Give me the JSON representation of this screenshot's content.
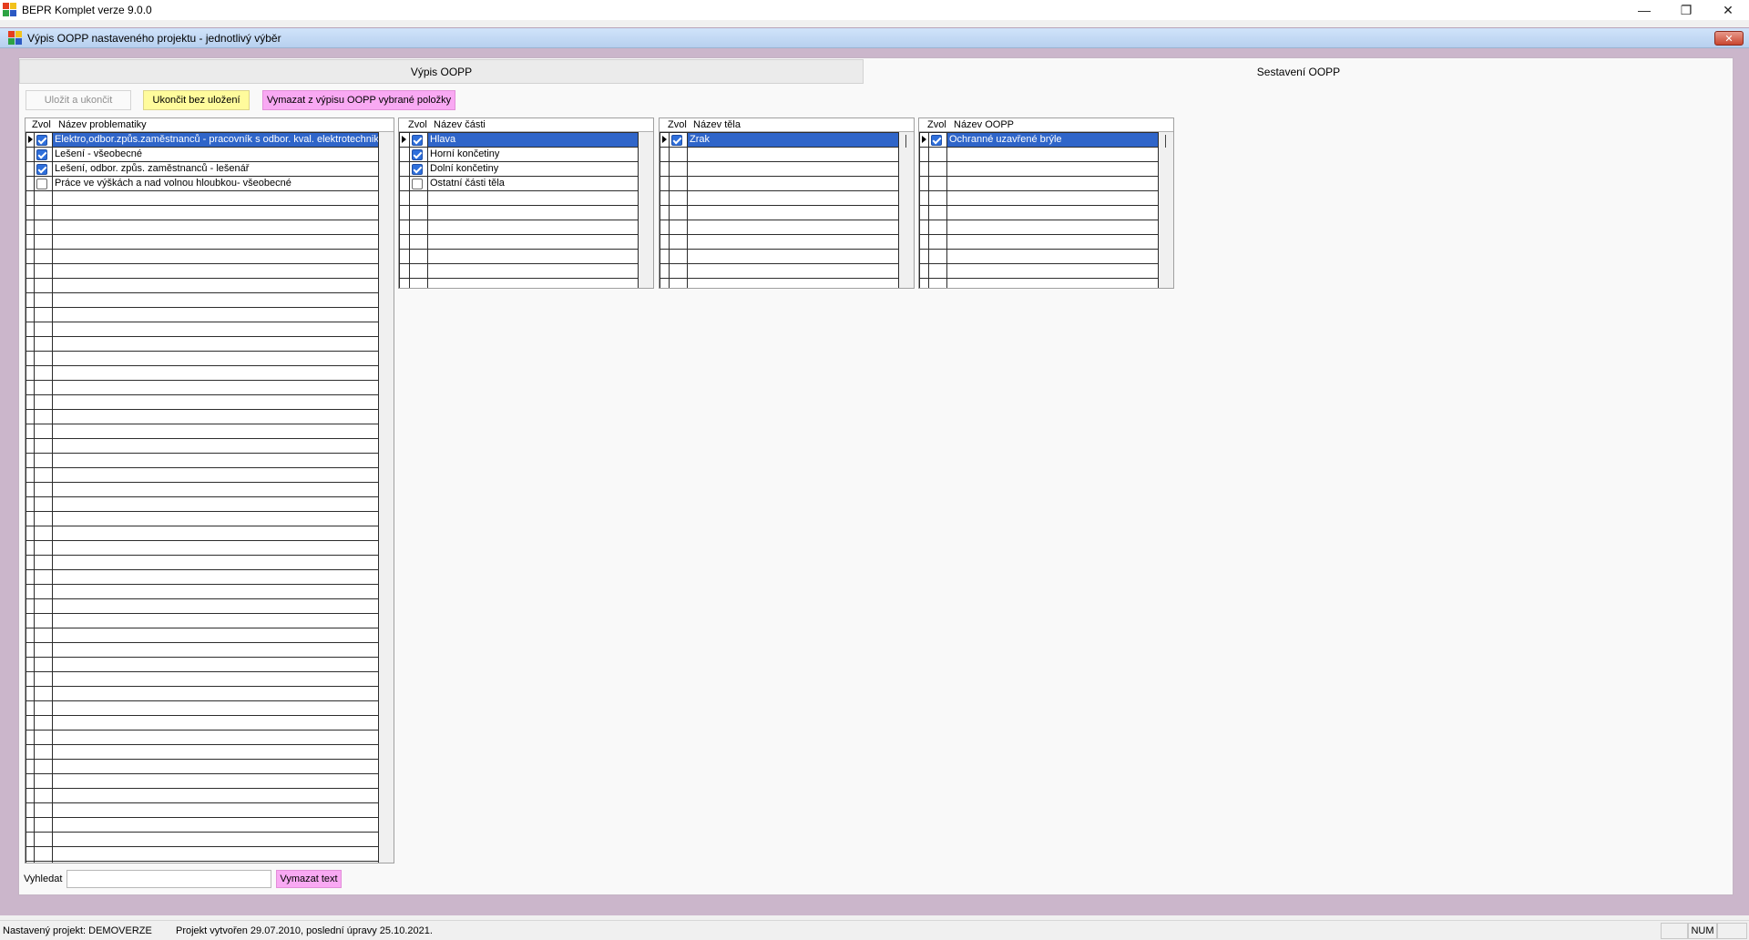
{
  "app": {
    "title": "BEPR Komplet verze 9.0.0",
    "window_controls": {
      "minimize": "—",
      "restore": "❐",
      "close": "✕"
    }
  },
  "child_window": {
    "title": "Výpis OOPP nastaveného projektu - jednotlivý výběr",
    "close": "✕"
  },
  "tabs": [
    {
      "label": "Výpis OOPP",
      "active": false
    },
    {
      "label": "Sestavení OOPP",
      "active": true
    }
  ],
  "toolbar": {
    "save_exit": "Uložit a ukončit",
    "exit_nosave": "Ukončit bez uložení",
    "delete_selected": "Vymazat z výpisu OOPP vybrané položky"
  },
  "grids": {
    "problematika": {
      "col_select": "Zvol",
      "col_name": "Název problematiky",
      "rows": [
        {
          "checked": true,
          "text": "Elektro,odbor.způs.zaměstnanců - pracovník s odbor. kval. elektrotechnika",
          "selected": true
        },
        {
          "checked": true,
          "text": "Lešení - všeobecné",
          "selected": false
        },
        {
          "checked": true,
          "text": "Lešení, odbor. způs. zaměstnanců - lešenář",
          "selected": false
        },
        {
          "checked": false,
          "text": "Práce ve výškách a nad volnou hloubkou- všeobecné",
          "selected": false
        }
      ]
    },
    "casti": {
      "col_select": "Zvol",
      "col_name": "Název části",
      "rows": [
        {
          "checked": true,
          "text": "Hlava",
          "selected": true
        },
        {
          "checked": true,
          "text": "Horní končetiny",
          "selected": false
        },
        {
          "checked": true,
          "text": "Dolní končetiny",
          "selected": false
        },
        {
          "checked": false,
          "text": "Ostatní části těla",
          "selected": false
        }
      ]
    },
    "tela": {
      "col_select": "Zvol",
      "col_name": "Název těla",
      "rows": [
        {
          "checked": true,
          "text": "Zrak",
          "selected": true
        }
      ]
    },
    "oopp": {
      "col_select": "Zvol",
      "col_name": "Název OOPP",
      "rows": [
        {
          "checked": true,
          "text": "Ochranné uzavřené brýle",
          "selected": true
        }
      ]
    }
  },
  "search": {
    "label": "Vyhledat",
    "value": "",
    "clear_button": "Vymazat text"
  },
  "status": {
    "project": "Nastavený projekt: DEMOVERZE",
    "info": "Projekt vytvořen 29.07.2010, poslední úpravy 25.10.2021.",
    "num": "NUM"
  }
}
